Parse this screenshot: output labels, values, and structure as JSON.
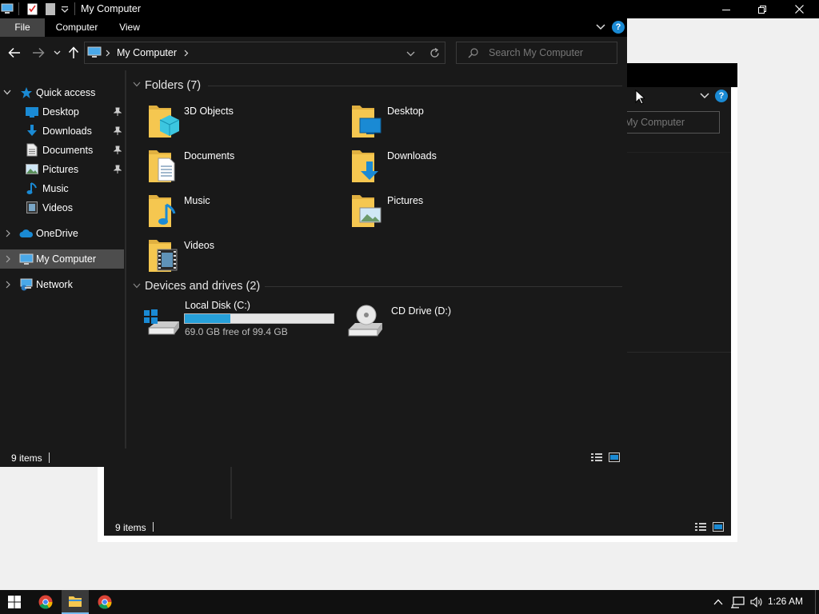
{
  "window": {
    "title": "My Computer",
    "ribbon_tabs": [
      "File",
      "Computer",
      "View"
    ],
    "address_path": "My Computer",
    "search_placeholder": "Search My Computer",
    "status_items": "9 items"
  },
  "nav": {
    "quick_access": "Quick access",
    "items": [
      {
        "label": "Desktop",
        "icon": "desktop-icon",
        "pinned": true
      },
      {
        "label": "Downloads",
        "icon": "downloads-icon",
        "pinned": true
      },
      {
        "label": "Documents",
        "icon": "documents-icon",
        "pinned": true
      },
      {
        "label": "Pictures",
        "icon": "pictures-icon",
        "pinned": true
      },
      {
        "label": "Music",
        "icon": "music-icon",
        "pinned": false
      },
      {
        "label": "Videos",
        "icon": "videos-icon",
        "pinned": false
      }
    ],
    "onedrive": "OneDrive",
    "my_computer": "My Computer",
    "network": "Network"
  },
  "content": {
    "folders_header": "Folders (7)",
    "folders": [
      "3D Objects",
      "Desktop",
      "Documents",
      "Downloads",
      "Music",
      "Pictures",
      "Videos"
    ],
    "drives_header": "Devices and drives (2)",
    "drives": [
      {
        "label": "Local Disk (C:)",
        "free_text": "69.0 GB free of 99.4 GB",
        "used_fraction": 0.306
      },
      {
        "label": "CD Drive (D:)"
      }
    ]
  },
  "background_window": {
    "search_text": "My Computer",
    "status_items": "9 items"
  },
  "taskbar": {
    "time": "1:26 AM"
  },
  "colors": {
    "accent": "#1a8ad4",
    "folder": "#f5c750",
    "dark_bg": "#191919",
    "selected": "#4d4d4d"
  }
}
